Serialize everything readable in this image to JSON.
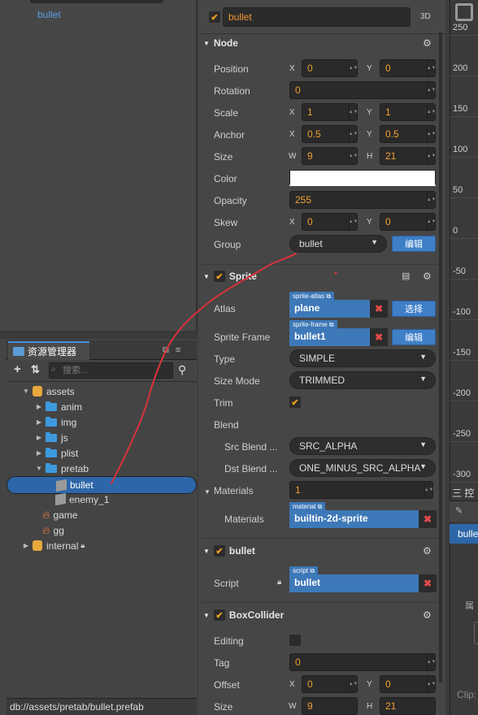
{
  "hierarchy": {
    "node_label": "bullet"
  },
  "assets_panel": {
    "tab_title": "资源管理器",
    "search_placeholder": "搜索...",
    "tree": [
      {
        "label": "assets",
        "icon": "db-icon",
        "arrow": "▼"
      },
      {
        "label": "anim",
        "icon": "folder-icon",
        "arrow": "▶"
      },
      {
        "label": "img",
        "icon": "folder-icon",
        "arrow": "▶"
      },
      {
        "label": "js",
        "icon": "folder-icon",
        "arrow": "▶"
      },
      {
        "label": "plist",
        "icon": "folder-icon",
        "arrow": "▶"
      },
      {
        "label": "pretab",
        "icon": "folder-icon",
        "arrow": "▼"
      },
      {
        "label": "bullet",
        "icon": "prefab-icon",
        "arrow": ""
      },
      {
        "label": "enemy_1",
        "icon": "prefab-icon",
        "arrow": ""
      },
      {
        "label": "game",
        "icon": "fire-icon",
        "arrow": ""
      },
      {
        "label": "gg",
        "icon": "fire-icon",
        "arrow": ""
      },
      {
        "label": "internal",
        "icon": "db-icon",
        "arrow": "▶"
      }
    ],
    "status_path": "db://assets/pretab/bullet.prefab"
  },
  "inspector": {
    "node_name": "bullet",
    "toggle_3d": "3D",
    "node_section": {
      "title": "Node",
      "position": {
        "label": "Position",
        "x": "0",
        "y": "0"
      },
      "rotation": {
        "label": "Rotation",
        "value": "0"
      },
      "scale": {
        "label": "Scale",
        "x": "1",
        "y": "1"
      },
      "anchor": {
        "label": "Anchor",
        "x": "0.5",
        "y": "0.5"
      },
      "size": {
        "label": "Size",
        "w": "9",
        "h": "21"
      },
      "color": {
        "label": "Color",
        "value": "#ffffff"
      },
      "opacity": {
        "label": "Opacity",
        "value": "255"
      },
      "skew": {
        "label": "Skew",
        "x": "0",
        "y": "0"
      },
      "group": {
        "label": "Group",
        "value": "bullet",
        "edit_button": "编辑"
      }
    },
    "sprite_section": {
      "title": "Sprite",
      "atlas": {
        "label": "Atlas",
        "tag": "sprite-atlas",
        "value": "plane",
        "button": "选择"
      },
      "sprite_frame": {
        "label": "Sprite Frame",
        "tag": "sprite-frame",
        "value": "bullet1",
        "button": "编辑"
      },
      "type": {
        "label": "Type",
        "value": "SIMPLE"
      },
      "size_mode": {
        "label": "Size Mode",
        "value": "TRIMMED"
      },
      "trim": {
        "label": "Trim",
        "checked": true
      },
      "blend": {
        "label": "Blend"
      },
      "src_blend": {
        "label": "Src Blend ...",
        "value": "SRC_ALPHA"
      },
      "dst_blend": {
        "label": "Dst Blend ...",
        "value": "ONE_MINUS_SRC_ALPHA"
      },
      "materials_count": {
        "label": "Materials",
        "value": "1"
      },
      "materials": {
        "label": "Materials",
        "tag": "material",
        "value": "builtin-2d-sprite"
      }
    },
    "bullet_section": {
      "title": "bullet",
      "script": {
        "label": "Script",
        "tag": "script",
        "value": "bullet"
      }
    },
    "box_section": {
      "title": "BoxCollider",
      "editing": {
        "label": "Editing"
      },
      "tag": {
        "label": "Tag",
        "value": "0"
      },
      "offset": {
        "label": "Offset",
        "x": "0",
        "y": "0"
      },
      "size": {
        "label": "Size",
        "w": "9",
        "h": "21"
      }
    }
  },
  "scene": {
    "ruler_ticks": [
      "250",
      "200",
      "150",
      "100",
      "50",
      "0",
      "-50",
      "-100",
      "-150",
      "-200",
      "-250",
      "-300"
    ],
    "panel_tab": "三 控",
    "row_label": "bulle",
    "label_2": "属",
    "clip_label": "Clip:"
  },
  "colors": {
    "accent": "#2d67a9",
    "value_text": "#f0a030",
    "remove": "#e24a4a"
  }
}
